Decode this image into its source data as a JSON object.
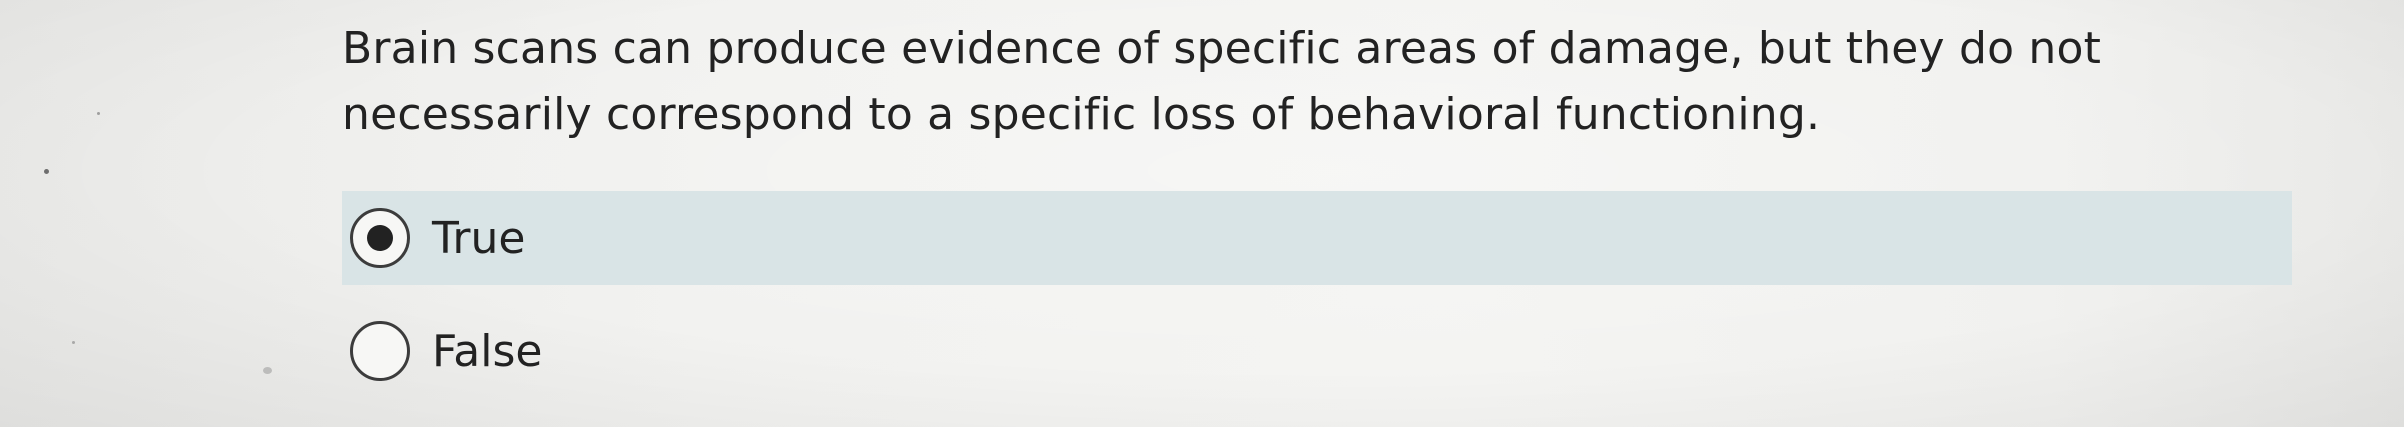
{
  "question": {
    "text": "Brain scans can produce evidence of specific areas of damage, but they do not necessarily correspond to a specific loss of behavioral functioning."
  },
  "options": [
    {
      "label": "True",
      "selected": true
    },
    {
      "label": "False",
      "selected": false
    }
  ],
  "colors": {
    "selected_row": "#d9e4e6",
    "text": "#222222",
    "radio_border": "#3c3c3c"
  }
}
